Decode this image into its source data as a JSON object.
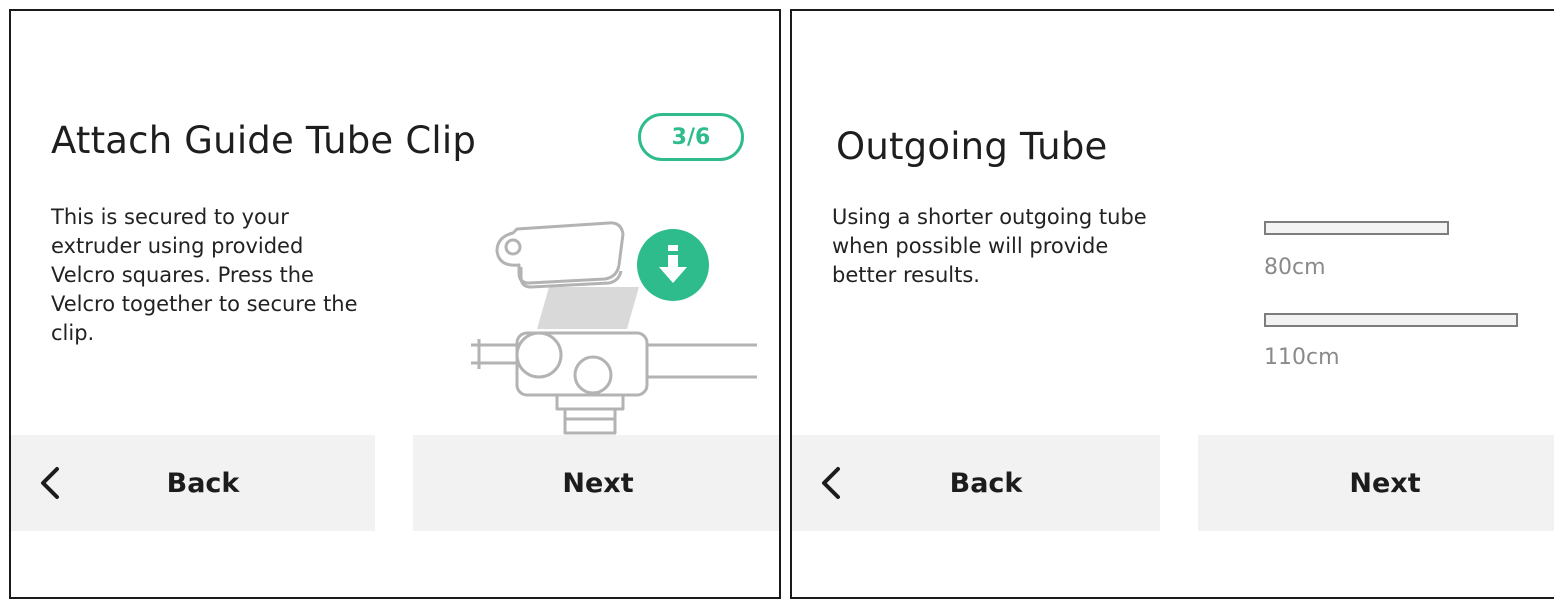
{
  "left": {
    "title": "Attach Guide Tube Clip",
    "step": "3/6",
    "body_lines": [
      "This is secured to your",
      "extruder using provided",
      "Velcro squares. Press the",
      "Velcro together to secure the",
      "clip."
    ],
    "back_label": "Back",
    "next_label": "Next",
    "icons": [
      "clip-illustration",
      "download-arrow-icon",
      "chevron-left-icon"
    ],
    "accent_color": "#2fbc8c"
  },
  "right": {
    "title": "Outgoing Tube",
    "body_lines": [
      "Using a shorter outgoing tube",
      "when possible will provide",
      "better results."
    ],
    "tubes": [
      {
        "label": "80cm",
        "length_cm": 80
      },
      {
        "label": "110cm",
        "length_cm": 110
      }
    ],
    "back_label": "Back",
    "next_label": "Next",
    "icons": [
      "chevron-left-icon"
    ]
  }
}
